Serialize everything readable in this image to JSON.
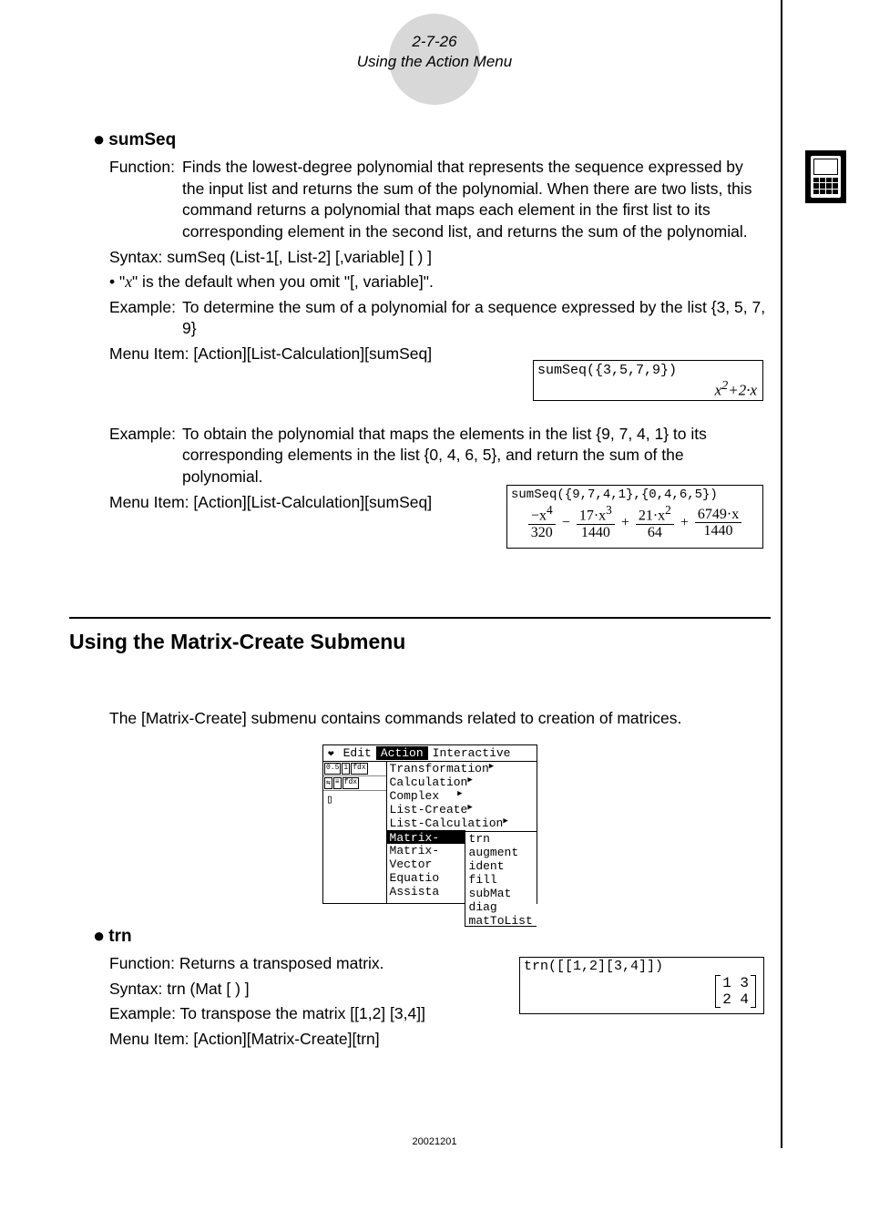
{
  "header": {
    "page_ref": "2-7-26",
    "section": "Using the Action Menu"
  },
  "sumseq": {
    "title": "sumSeq",
    "function_label": "Function:",
    "function_text": "Finds the lowest-degree polynomial that represents the sequence expressed by the input list and returns the sum of the polynomial. When there are two lists, this command returns a polynomial that maps each element in the first list to its corresponding element in the second list, and returns the sum of the polynomial.",
    "syntax_label": "Syntax:",
    "syntax_text": "sumSeq (List-1[, List-2] [,variable] [ ) ]",
    "note_prefix": "• \"",
    "note_var": "x",
    "note_suffix": "\" is the default when you omit \"[, variable]\".",
    "example1_label": "Example:",
    "example1_text": "To determine the sum of a polynomial for a sequence expressed by the list {3, 5, 7, 9}",
    "menu1_label": "Menu Item:",
    "menu1_text": "[Action][List-Calculation][sumSeq]",
    "screen1_input": "sumSeq({3,5,7,9})",
    "screen1_result_a": "x",
    "screen1_result_sup": "2",
    "screen1_result_b": "+2·x",
    "example2_label": "Example:",
    "example2_text": "To obtain the polynomial that maps the elements in the list {9, 7, 4, 1} to its corresponding elements in the list {0, 4, 6, 5}, and return the sum of the polynomial.",
    "menu2_label": "Menu Item:",
    "menu2_text": "[Action][List-Calculation][sumSeq]",
    "screen2_input": "sumSeq({9,7,4,1},{0,4,6,5})",
    "frac": {
      "t1n": "−x",
      "t1s": "4",
      "t1d": "320",
      "op1": "−",
      "t2n": "17·x",
      "t2s": "3",
      "t2d": "1440",
      "op2": "+",
      "t3n": "21·x",
      "t3s": "2",
      "t3d": "64",
      "op3": "+",
      "t4n": "6749·x",
      "t4d": "1440"
    }
  },
  "matrix_section": {
    "heading": "Using the Matrix-Create Submenu",
    "intro": "The [Matrix-Create] submenu contains commands related to creation of matrices."
  },
  "menu_shot": {
    "bar": {
      "heart": "❤",
      "edit": "Edit",
      "action": "Action",
      "interactive": "Interactive"
    },
    "col1": [
      "Transformation",
      "Calculation",
      "Complex",
      "List-Create",
      "List-Calculation",
      "Matrix-",
      "Matrix-",
      "Vector",
      "Equatio",
      "Assista"
    ],
    "col1_hl_index": 5,
    "col2": [
      "trn",
      "augment",
      "ident",
      "fill",
      "subMat",
      "diag",
      "matToList"
    ]
  },
  "trn": {
    "title": "trn",
    "function_label": "Function:",
    "function_text": "Returns a transposed matrix.",
    "syntax_label": "Syntax:",
    "syntax_text": "trn (Mat [ ) ]",
    "example_label": "Example:",
    "example_text": "To transpose the matrix [[1,2] [3,4]]",
    "menu_label": "Menu Item:",
    "menu_text": "[Action][Matrix-Create][trn]",
    "screen_input": "trn([[1,2][3,4]])",
    "matrix": {
      "r1": "1 3",
      "r2": "2 4"
    }
  },
  "footer": "20021201"
}
